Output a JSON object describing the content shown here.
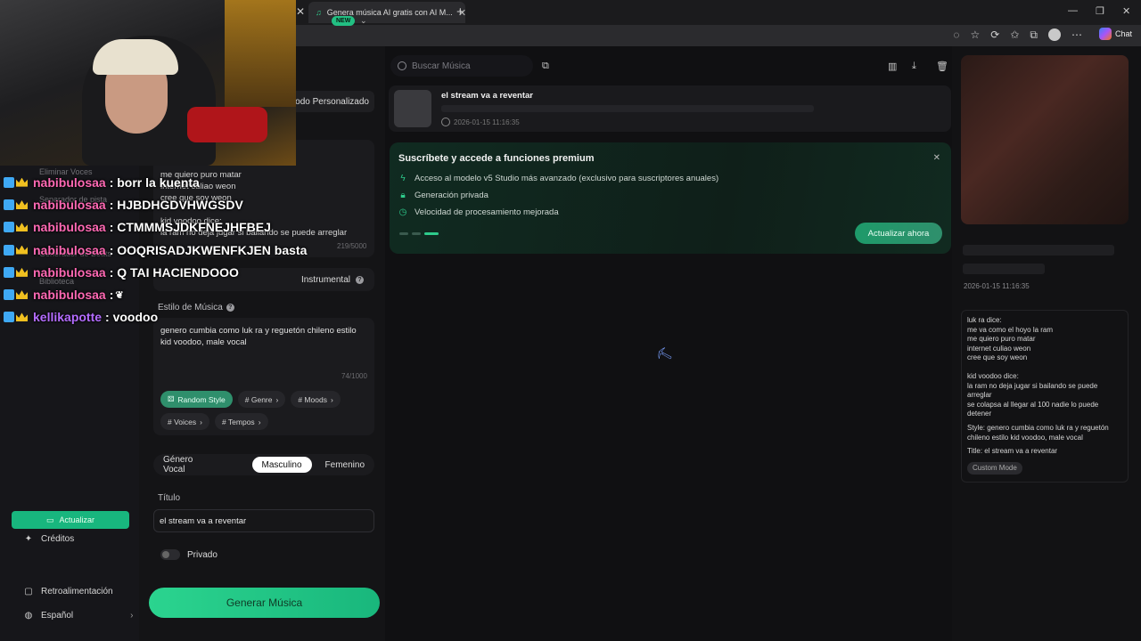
{
  "browser": {
    "tab_title": "Genera música AI gratis con AI M...",
    "chat_label": "Chat"
  },
  "sidebar": {
    "faded_items": [
      "Eliminar Voces",
      "Separador de pista",
      "Generador de Beats",
      "Biblioteca"
    ],
    "credits_label": "Créditos",
    "upgrade_label": "Actualizar",
    "feedback_label": "Retroalimentación",
    "language_label": "Español"
  },
  "chat": [
    {
      "user": "nabibulosaa",
      "message": ": borr la kuenta"
    },
    {
      "user": "nabibulosaa",
      "message": ": HJBDHGDVHWGSDV"
    },
    {
      "user": "nabibulosaa",
      "message": ": CTMMMSJDKFNEJHFBEJ"
    },
    {
      "user": "nabibulosaa",
      "message": ": OOQRISADJKWENFKJEN basta"
    },
    {
      "user": "nabibulosaa",
      "message": ": Q TAI HACIENDOOO"
    },
    {
      "user": "nabibulosaa",
      "message": ": "
    },
    {
      "user": "kellikapotte",
      "message": ": voodoo"
    }
  ],
  "form": {
    "new_badge": "NEW",
    "mode_label": "Modo Personalizado",
    "lyrics_visible": "me quiero puro matar\ninternet culiao weon\ncree que soy weon\n\nkid voodoo dice:\nla ram no deja jugar si bailando se puede arreglar",
    "lyrics_count": "219/5000",
    "instrumental_label": "Instrumental",
    "style_label": "Estilo de Música",
    "style_value": "genero cumbia como luk ra y reguetón chileno estilo kid voodoo, male vocal",
    "style_count": "74/1000",
    "chips": [
      "Random Style",
      "# Genre",
      "# Moods",
      "# Voices",
      "# Tempos"
    ],
    "vocal_label": "Género Vocal",
    "vocal_options": [
      "Masculino",
      "Femenino"
    ],
    "title_label": "Título",
    "title_value": "el stream va a reventar",
    "private_label": "Privado",
    "generate_label": "Generar Música"
  },
  "main": {
    "search_placeholder": "Buscar Música",
    "song": {
      "title": "el stream va a reventar",
      "date": "2026-01-15 11:16:35"
    },
    "premium": {
      "title": "Suscríbete y accede a funciones premium",
      "features": [
        "Acceso al modelo v5 Studio más avanzado (exclusivo para suscriptores anuales)",
        "Generación privada",
        "Velocidad de procesamiento mejorada"
      ],
      "button": "Actualizar ahora"
    }
  },
  "right_panel": {
    "date": "2026-01-15 11:16:35",
    "lyrics_block1": [
      "luk ra dice:",
      "me va como el hoyo la ram",
      "me quiero puro matar",
      "internet culiao weon",
      "cree que soy weon"
    ],
    "lyrics_block2": [
      "kid voodoo dice:",
      "la ram no deja jugar si bailando se puede arreglar",
      "se colapsa al llegar al 100 nadie lo puede detener"
    ],
    "style_line": "Style:  genero cumbia como luk ra y reguetón chileno estilo kid voodoo, male vocal",
    "title_line": "Title:  el stream va a reventar",
    "mode_tag": "Custom Mode"
  }
}
